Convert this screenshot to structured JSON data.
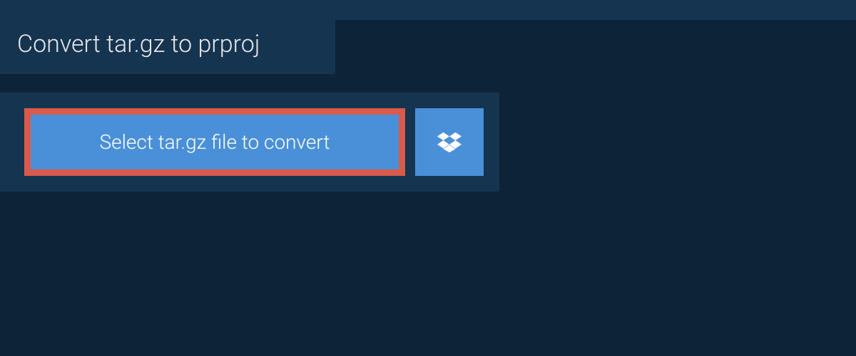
{
  "header": {
    "title": "Convert tar.gz to prproj"
  },
  "panel": {
    "select_label": "Select tar.gz file to convert"
  },
  "colors": {
    "bg": "#0d2438",
    "panel": "#153450",
    "button": "#4a90d9",
    "highlight_border": "#d85a4a"
  }
}
